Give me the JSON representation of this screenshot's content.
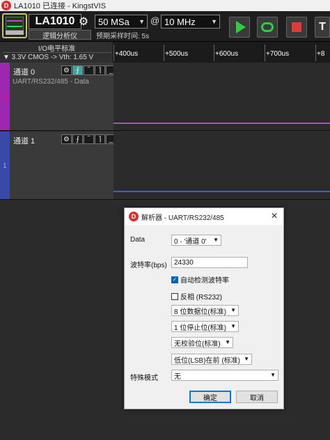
{
  "window": {
    "title": "LA1010 已连接 - KingstVIS",
    "logo": "D"
  },
  "toolbar": {
    "device_name": "LA1010",
    "device_subtitle": "逻辑分析仪",
    "sample_count": "50 MSa",
    "at_symbol": "@",
    "sample_rate": "10 MHz",
    "estimate": "预期采样时间: 5s",
    "start_label": "▶",
    "terminal_label": "T"
  },
  "io": {
    "header": "I/O电平标准",
    "standard": "▼ 3.3V CMOS -> Vth: 1.65 V"
  },
  "timeline": {
    "ticks": [
      "+400us",
      "+500us",
      "+600us",
      "+700us",
      "+8"
    ]
  },
  "channels": [
    {
      "name": "通道 0",
      "index": "0",
      "decoder": "UART/RS232/485 - Data",
      "color": "#e040fb"
    },
    {
      "name": "通道 1",
      "index": "1",
      "decoder": "",
      "color": "#3d5afe"
    }
  ],
  "dialog": {
    "title": "解析器 - UART/RS232/485",
    "logo": "D",
    "data_label": "Data",
    "data_value": "0 - '通道 0'",
    "baud_label": "波特率(bps)",
    "baud_value": "24330",
    "autodetect_label": "自动检测波特率",
    "autodetect_checked": true,
    "invert_label": "反相 (RS232)",
    "invert_checked": false,
    "data_bits": "8 位数据位(标准)",
    "stop_bits": "1 位停止位(标准)",
    "parity": "无校验位(标准)",
    "bit_order": "低位(LSB)在前 (标准)",
    "special_label": "特殊模式",
    "special_value": "无",
    "ok_label": "确定",
    "cancel_label": "取消"
  }
}
